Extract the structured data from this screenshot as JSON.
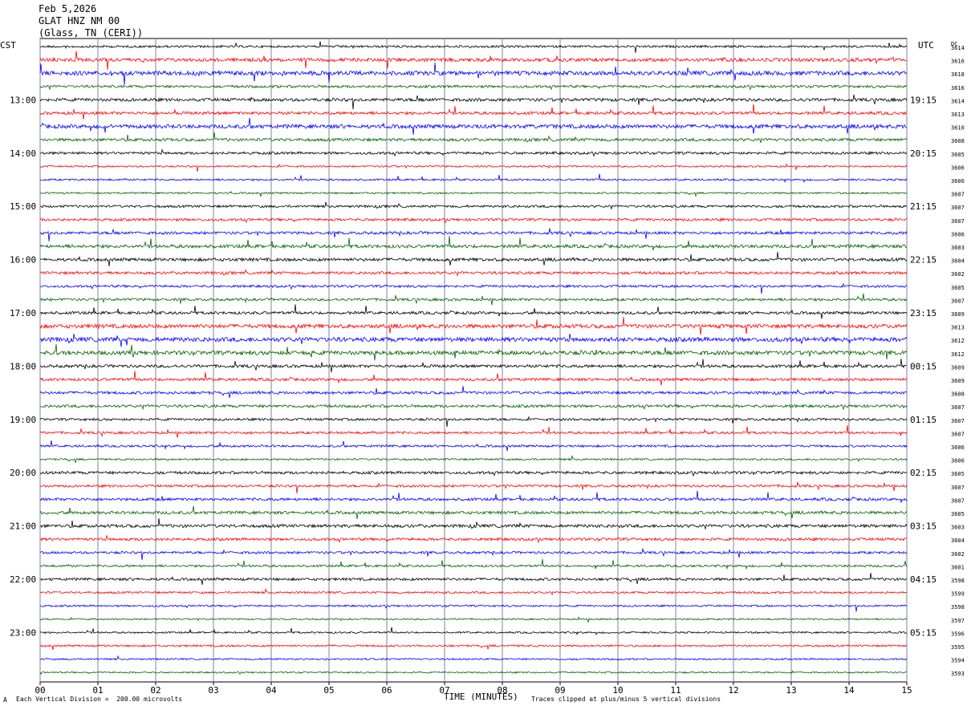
{
  "header": {
    "date": "Feb 5,2026",
    "station": "GLAT HNZ NM 00",
    "location": "(Glass, TN (CERI))"
  },
  "left_axis_label": "CST",
  "right_axis_label": "UTC",
  "dc_label": "DC",
  "footer": {
    "scale_note": "Each Vertical Division =  200.00 microvolts",
    "clip_note": "Traces clipped at plus/minus 5 vertical divisions",
    "corner_mark": "A"
  },
  "colors": {
    "black": "#000000",
    "red": "#ff0000",
    "blue": "#0000ff",
    "green": "#006400",
    "grid": "#8080a0"
  },
  "chart_data": {
    "type": "line",
    "xlabel": "TIME (MINUTES)",
    "x_ticks": [
      "00",
      "01",
      "02",
      "03",
      "04",
      "05",
      "06",
      "07",
      "08",
      "09",
      "10",
      "11",
      "12",
      "13",
      "14",
      "15"
    ],
    "xlim": [
      0,
      15
    ],
    "trace_color_cycle": [
      "black",
      "red",
      "blue",
      "green"
    ],
    "left_hour_labels": [
      "13:00",
      "14:00",
      "15:00",
      "16:00",
      "17:00",
      "18:00",
      "19:00",
      "20:00",
      "21:00",
      "22:00",
      "23:00"
    ],
    "right_hour_labels": [
      "19:15",
      "20:15",
      "21:15",
      "22:15",
      "23:15",
      "00:15",
      "01:15",
      "02:15",
      "03:15",
      "04:15",
      "05:15"
    ],
    "dc_values": [
      "3614",
      "3616",
      "3618",
      "3616",
      "3614",
      "3613",
      "3610",
      "3608",
      "3605",
      "3606",
      "3606",
      "3607",
      "3607",
      "3607",
      "3606",
      "3603",
      "3604",
      "3602",
      "3605",
      "3607",
      "3609",
      "3613",
      "3612",
      "3612",
      "3609",
      "3609",
      "3608",
      "3607",
      "3607",
      "3607",
      "3606",
      "3606",
      "3605",
      "3607",
      "3607",
      "3605",
      "3603",
      "3604",
      "3602",
      "3601",
      "3598",
      "3599",
      "3598",
      "3597",
      "3596",
      "3595",
      "3594",
      "3593"
    ],
    "activity_levels": [
      0.35,
      0.7,
      0.9,
      0.45,
      0.6,
      0.55,
      0.8,
      0.55,
      0.45,
      0.2,
      0.25,
      0.2,
      0.4,
      0.45,
      0.5,
      0.65,
      0.6,
      0.5,
      0.4,
      0.45,
      0.5,
      0.8,
      0.95,
      0.85,
      0.55,
      0.5,
      0.5,
      0.5,
      0.4,
      0.4,
      0.35,
      0.25,
      0.5,
      0.4,
      0.5,
      0.55,
      0.6,
      0.5,
      0.4,
      0.35,
      0.45,
      0.3,
      0.25,
      0.15,
      0.2,
      0.25,
      0.2,
      0.15
    ],
    "scale_microvolts_per_division": 200
  }
}
